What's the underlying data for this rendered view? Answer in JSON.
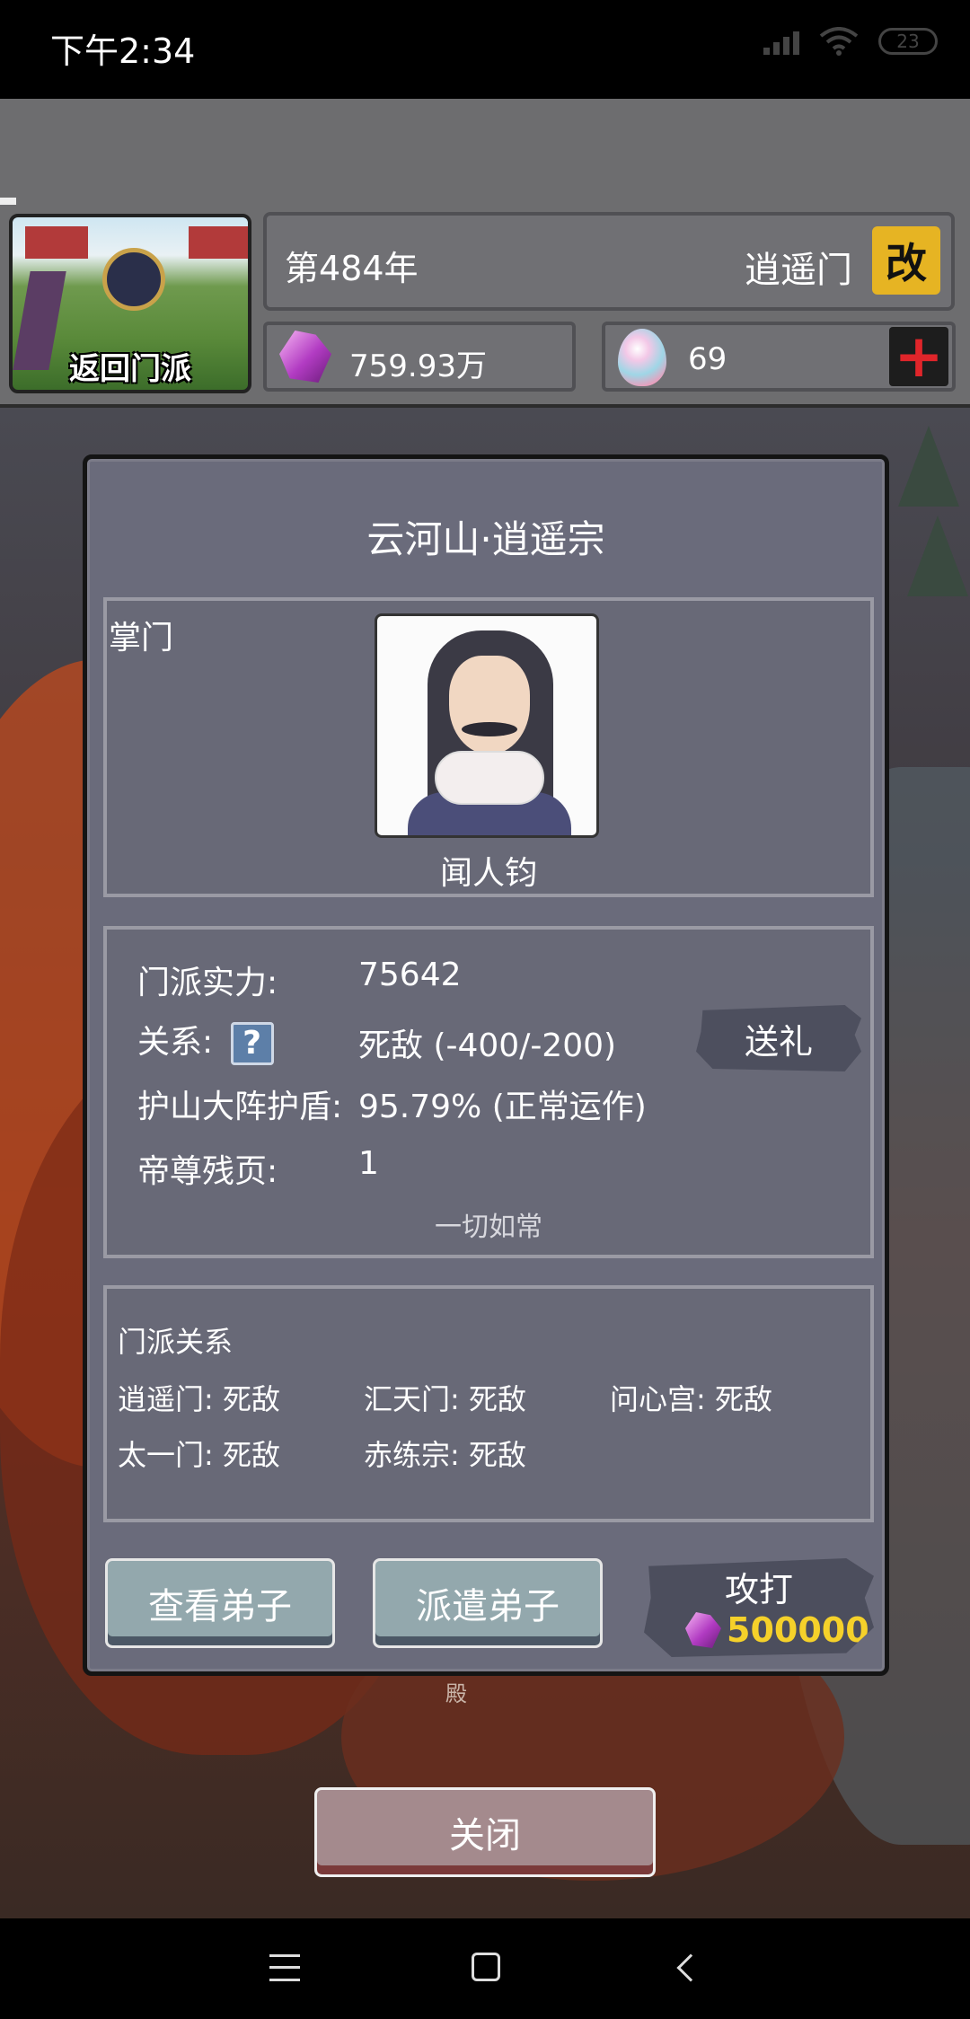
{
  "status": {
    "time": "下午2:34",
    "battery": "23"
  },
  "header": {
    "return_label": "返回门派",
    "year": "第484年",
    "sect_name": "逍遥门",
    "rename_label": "改",
    "spirit_stones": "759.93万",
    "eggs": "69",
    "add_label": "+"
  },
  "dialog": {
    "title": "云河山·逍遥宗",
    "leader": {
      "label": "掌门",
      "name": "闻人钧"
    },
    "info": {
      "power_label": "门派实力:",
      "power_value": "75642",
      "relation_label": "关系:",
      "relation_help": "?",
      "relation_value": "死敌  (-400/-200)",
      "shield_label": "护山大阵护盾:",
      "shield_value": "95.79% (正常运作)",
      "pages_label": "帝尊残页:",
      "pages_value": "1",
      "status_text": "一切如常",
      "gift_label": "送礼"
    },
    "relations": {
      "title": "门派关系",
      "items": [
        "逍遥门: 死敌",
        "汇天门: 死敌",
        "问心宫: 死敌",
        "太一门: 死敌",
        "赤练宗: 死敌"
      ]
    },
    "buttons": {
      "view_disciples": "查看弟子",
      "dispatch_disciples": "派遣弟子",
      "attack": "攻打",
      "attack_cost": "500000"
    }
  },
  "background": {
    "hall_label": "殿"
  },
  "close_label": "关闭"
}
